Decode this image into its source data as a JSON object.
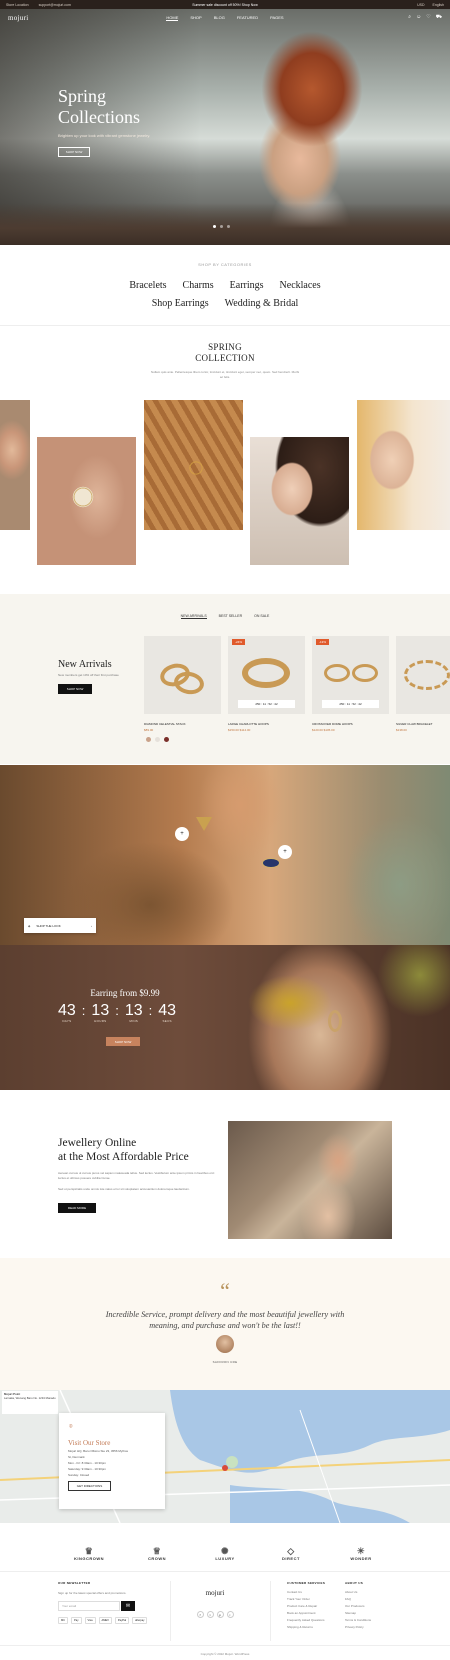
{
  "topbar": {
    "location": "Store Location",
    "email": "support@mojuri.com",
    "promo": "Summer sale discount off 50%! Shop Now",
    "currency": "USD",
    "language": "English"
  },
  "header": {
    "logo": "mojuri",
    "menu": [
      "HOME",
      "SHOP",
      "BLOG",
      "FEATURED",
      "PAGES"
    ]
  },
  "hero": {
    "title_line1": "Spring",
    "title_line2": "Collections",
    "subtitle": "Brighten up your look with vibrant gemstone jewelry.",
    "button": "SHOP NOW"
  },
  "categories": {
    "heading": "SHOP BY CATEGORIES",
    "row1": [
      "Bracelets",
      "Charms",
      "Earrings",
      "Necklaces"
    ],
    "row2": [
      "Shop Earrings",
      "Wedding & Bridal"
    ]
  },
  "spring_collection": {
    "title_line1": "SPRING",
    "title_line2": "COLLECTION",
    "description": "Nullam quis ante. Pellentesque libero tortor, tincidunt et, tincidunt eget, semper nec, quam. Sed hendrerit. Morbi ac felis."
  },
  "tabs": [
    "NEW ARRIVALS",
    "BEST SELLER",
    "ON SALE"
  ],
  "new_arrivals": {
    "title": "New Arrivals",
    "subtitle": "New members get 10% off their first purchase",
    "button": "SHOP NOW"
  },
  "products": [
    {
      "name": "DIAMOND CELESTIAL STACK",
      "price": "$89.00",
      "badge": "",
      "timer": ""
    },
    {
      "name": "LARGE CHARLOTTE HOOPS",
      "price": "$150.00 $114.00",
      "badge": "-24%",
      "timer": "250 : 11 : 52 : 42"
    },
    {
      "name": "CROSSOVER DOME HOOPS",
      "price": "$120.00 $105.00",
      "badge": "-13%",
      "timer": "250 : 11 : 52 : 42"
    },
    {
      "name": "SILVER CLAW BRACELET",
      "price": "$138.00",
      "badge": "",
      "timer": ""
    }
  ],
  "swatch_colors": [
    "#c9a28a",
    "#e6e1db",
    "#7a2f2a"
  ],
  "lifestyle_tag": {
    "label": "SHOP THE LOOK"
  },
  "deal": {
    "title": "Earring from $9.99",
    "countdown": [
      {
        "value": "43",
        "label": "DAYS"
      },
      {
        "value": "13",
        "label": "HOURS"
      },
      {
        "value": "13",
        "label": "MINS"
      },
      {
        "value": "43",
        "label": "SECS"
      }
    ],
    "button": "SHOP NOW"
  },
  "jewellery_online": {
    "title_line1": "Jewellery Online",
    "title_line2": "at the Most Affordable Price",
    "p1": "Aenean cursus ut cursus purus vel sapien malesuada tellus. Sed lectus. Vestibulum ante ipsum primis in faucibus orci luctus et ultrices posuere cubilia Curae.",
    "p2": "Sed ut perspiciatis unde omnis iste natus error sit voluptatem accusantium doloremque laudantium.",
    "button": "READ MORE"
  },
  "testimonial": {
    "quote_mark": "“",
    "text": "Incredible Service, prompt delivery and the most beautiful jewellery with meaning, and purchase and won't be the last!!",
    "name": "SAFFRON CRE"
  },
  "map": {
    "info_title": "Mojuri Point",
    "info_text": "Larnaka, Wenang Baru No. 1234 Manado",
    "store_title": "Visit Our Store",
    "store_lines": [
      "Mojuri HQ, Baru Ofisinu Ste 23, 4556 Mythos",
      "St, Denmark",
      "Mon - Fri: 8:30am - 10:30pm",
      "Saturday: 9:30am - 10:30pm",
      "Sunday: Closed"
    ],
    "button": "GET DIRECTIONS"
  },
  "brands": [
    {
      "name": "KINGCROWN",
      "icon": "crown-icon"
    },
    {
      "name": "CROWN",
      "icon": "crown-icon"
    },
    {
      "name": "LUXURY",
      "icon": "mandala-icon"
    },
    {
      "name": "DIRECT",
      "icon": "gem-icon"
    },
    {
      "name": "WONDER",
      "icon": "sun-icon"
    }
  ],
  "footer": {
    "newsletter_title": "OUR NEWSLETTER",
    "newsletter_sub": "Sign up for the latest special offers and promotions.",
    "email_placeholder": "Your email",
    "logo": "mojuri",
    "payments": [
      "MC",
      "Pay",
      "Visa",
      "AMEX",
      "PayPal",
      "afterpay"
    ],
    "social": [
      "f",
      "t",
      "p",
      "i"
    ],
    "cs_title": "CUSTOMER SERVICES",
    "cs_links": [
      "Contact Us",
      "Track Your Order",
      "Product Care & Repair",
      "Book an Appointment",
      "Frequently Asked Questions",
      "Shipping & Returns"
    ],
    "about_title": "ABOUT US",
    "about_links": [
      "About Us",
      "FAQ",
      "Our Producers",
      "Sitemap",
      "Terms & Conditions",
      "Privacy Policy"
    ],
    "copyright": "Copyright © 2022 Mojuri. WordPress"
  }
}
